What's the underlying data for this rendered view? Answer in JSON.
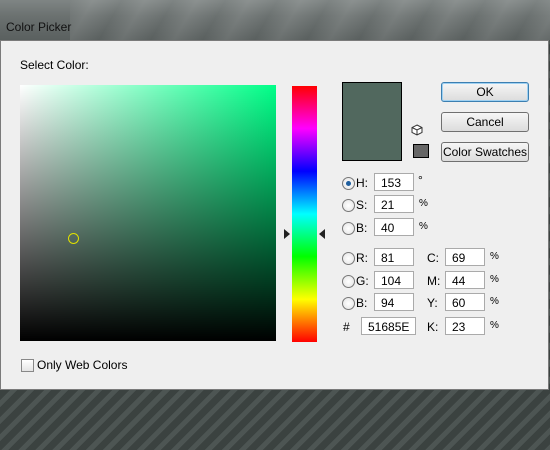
{
  "window": {
    "title": "Color Picker"
  },
  "picker": {
    "select_label": "Select Color:"
  },
  "buttons": {
    "ok": "OK",
    "cancel": "Cancel",
    "swatches": "Color Swatches"
  },
  "hsb": {
    "h": {
      "label": "H:",
      "value": "153",
      "unit": "°"
    },
    "s": {
      "label": "S:",
      "value": "21",
      "unit": "%"
    },
    "b": {
      "label": "B:",
      "value": "40",
      "unit": "%"
    }
  },
  "rgb": {
    "r": {
      "label": "R:",
      "value": "81"
    },
    "g": {
      "label": "G:",
      "value": "104"
    },
    "b": {
      "label": "B:",
      "value": "94"
    }
  },
  "cmyk": {
    "c": {
      "label": "C:",
      "value": "69",
      "unit": "%"
    },
    "m": {
      "label": "M:",
      "value": "44",
      "unit": "%"
    },
    "y": {
      "label": "Y:",
      "value": "60",
      "unit": "%"
    },
    "k": {
      "label": "K:",
      "value": "23",
      "unit": "%"
    }
  },
  "hex": {
    "label": "#",
    "value": "51685E"
  },
  "web_colors": {
    "label": "Only Web Colors",
    "checked": false
  },
  "colors": {
    "current": "#51685e",
    "websafe": "#666666"
  },
  "icons": {
    "gamut": "cube-icon"
  }
}
